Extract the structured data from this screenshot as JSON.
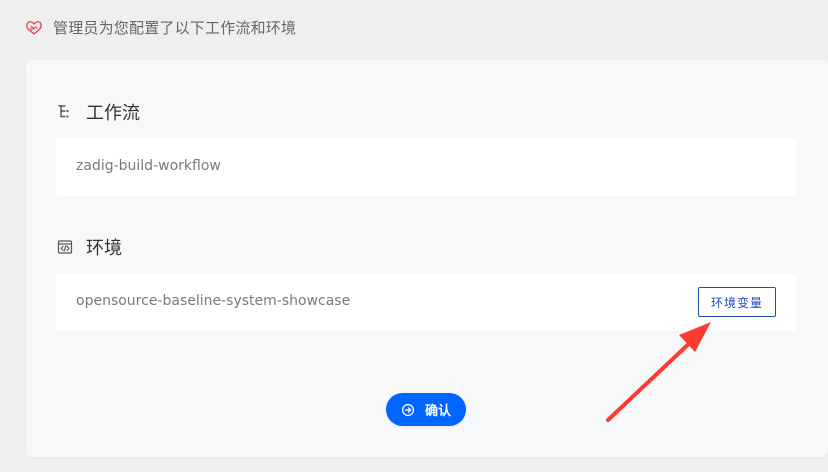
{
  "header": {
    "notice": "管理员为您配置了以下工作流和环境",
    "icon": "handshake-icon"
  },
  "workflow_section": {
    "title": "工作流",
    "icon": "workflow-icon",
    "items": [
      "zadig-build-workflow"
    ]
  },
  "environment_section": {
    "title": "环境",
    "icon": "code-window-icon",
    "items": [
      "opensource-baseline-system-showcase"
    ],
    "env_vars_label": "环境变量"
  },
  "actions": {
    "confirm_label": "确认",
    "confirm_icon": "arrow-right-circle-icon"
  },
  "colors": {
    "primary": "#0066ff",
    "accent_border": "#1f4db6",
    "arrow": "#ff3b30",
    "notice_icon": "#e0445a"
  }
}
